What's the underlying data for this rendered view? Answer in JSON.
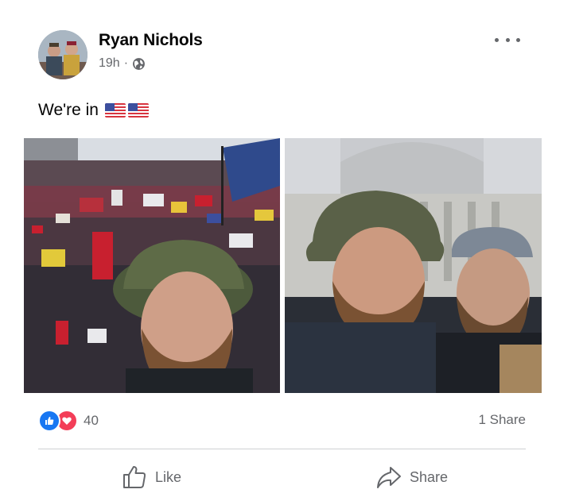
{
  "post": {
    "author": "Ryan Nichols",
    "time": "19h",
    "separator": "·",
    "privacy_icon": "globe-icon",
    "caption": "We're in",
    "caption_flags": [
      "us-flag-icon",
      "us-flag-icon"
    ],
    "more_icon": "more-options-icon"
  },
  "reactions": {
    "types": [
      "like",
      "love"
    ],
    "count": "40",
    "shares": "1 Share"
  },
  "actions": {
    "like_label": "Like",
    "share_label": "Share"
  },
  "colors": {
    "like_blue": "#1877f2",
    "love_red": "#f33e58",
    "secondary_text": "#65676b",
    "divider": "#ced0d4"
  }
}
